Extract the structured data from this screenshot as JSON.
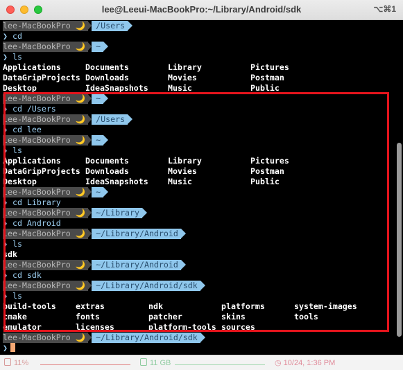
{
  "window": {
    "title": "lee@Leeui-MacBookPro:~/Library/Android/sdk",
    "shortcut": "⌥⌘1"
  },
  "prompt": {
    "host": "lee-MacBookPro",
    "moon": "🌙",
    "caret": "❯"
  },
  "lines": [
    {
      "type": "prompt",
      "dir": "/Users"
    },
    {
      "type": "cmd",
      "text": "cd"
    },
    {
      "type": "prompt",
      "dir": "~"
    },
    {
      "type": "cmd",
      "text": "ls"
    },
    {
      "type": "cols",
      "width": 119,
      "cells": [
        "Applications",
        "Documents",
        "Library",
        "Pictures"
      ]
    },
    {
      "type": "cols",
      "width": 119,
      "cells": [
        "DataGripProjects",
        "Downloads",
        "Movies",
        "Postman"
      ]
    },
    {
      "type": "cols",
      "width": 119,
      "cells": [
        "Desktop",
        "IdeaSnapshots",
        "Music",
        "Public"
      ]
    },
    {
      "type": "prompt",
      "dir": "~"
    },
    {
      "type": "cmd",
      "text": "cd /Users"
    },
    {
      "type": "prompt",
      "dir": "/Users"
    },
    {
      "type": "cmd",
      "text": "cd lee"
    },
    {
      "type": "prompt",
      "dir": "~"
    },
    {
      "type": "cmd",
      "text": "ls"
    },
    {
      "type": "cols",
      "width": 119,
      "cells": [
        "Applications",
        "Documents",
        "Library",
        "Pictures"
      ]
    },
    {
      "type": "cols",
      "width": 119,
      "cells": [
        "DataGripProjects",
        "Downloads",
        "Movies",
        "Postman"
      ]
    },
    {
      "type": "cols",
      "width": 119,
      "cells": [
        "Desktop",
        "IdeaSnapshots",
        "Music",
        "Public"
      ]
    },
    {
      "type": "prompt",
      "dir": "~"
    },
    {
      "type": "cmd",
      "text": "cd Library"
    },
    {
      "type": "prompt",
      "dir": "~/Library"
    },
    {
      "type": "cmd",
      "text": "cd Android"
    },
    {
      "type": "prompt",
      "dir": "~/Library/Android"
    },
    {
      "type": "cmd",
      "text": "ls"
    },
    {
      "type": "cols",
      "width": 119,
      "cells": [
        "sdk"
      ]
    },
    {
      "type": "prompt",
      "dir": "~/Library/Android"
    },
    {
      "type": "cmd",
      "text": "cd sdk"
    },
    {
      "type": "prompt",
      "dir": "~/Library/Android/sdk"
    },
    {
      "type": "cmd",
      "text": "ls"
    },
    {
      "type": "cols",
      "width": 105,
      "cells": [
        "build-tools",
        "extras",
        "ndk",
        "platforms",
        "system-images"
      ]
    },
    {
      "type": "cols",
      "width": 105,
      "cells": [
        "cmake",
        "fonts",
        "patcher",
        "skins",
        "tools"
      ]
    },
    {
      "type": "cols",
      "width": 105,
      "cells": [
        "emulator",
        "licenses",
        "platform-tools",
        "sources"
      ]
    },
    {
      "type": "prompt",
      "dir": "~/Library/Android/sdk"
    },
    {
      "type": "input"
    }
  ],
  "status": {
    "cpu": "11%",
    "memory": "11 GB",
    "clock": "10/24, 1:36 PM"
  },
  "colors": {
    "highlight_border": "#e5141c",
    "prompt_dir_bg": "#8fc7ec",
    "prompt_host_bg": "#4a4a4a",
    "cursor": "#f4a874"
  }
}
